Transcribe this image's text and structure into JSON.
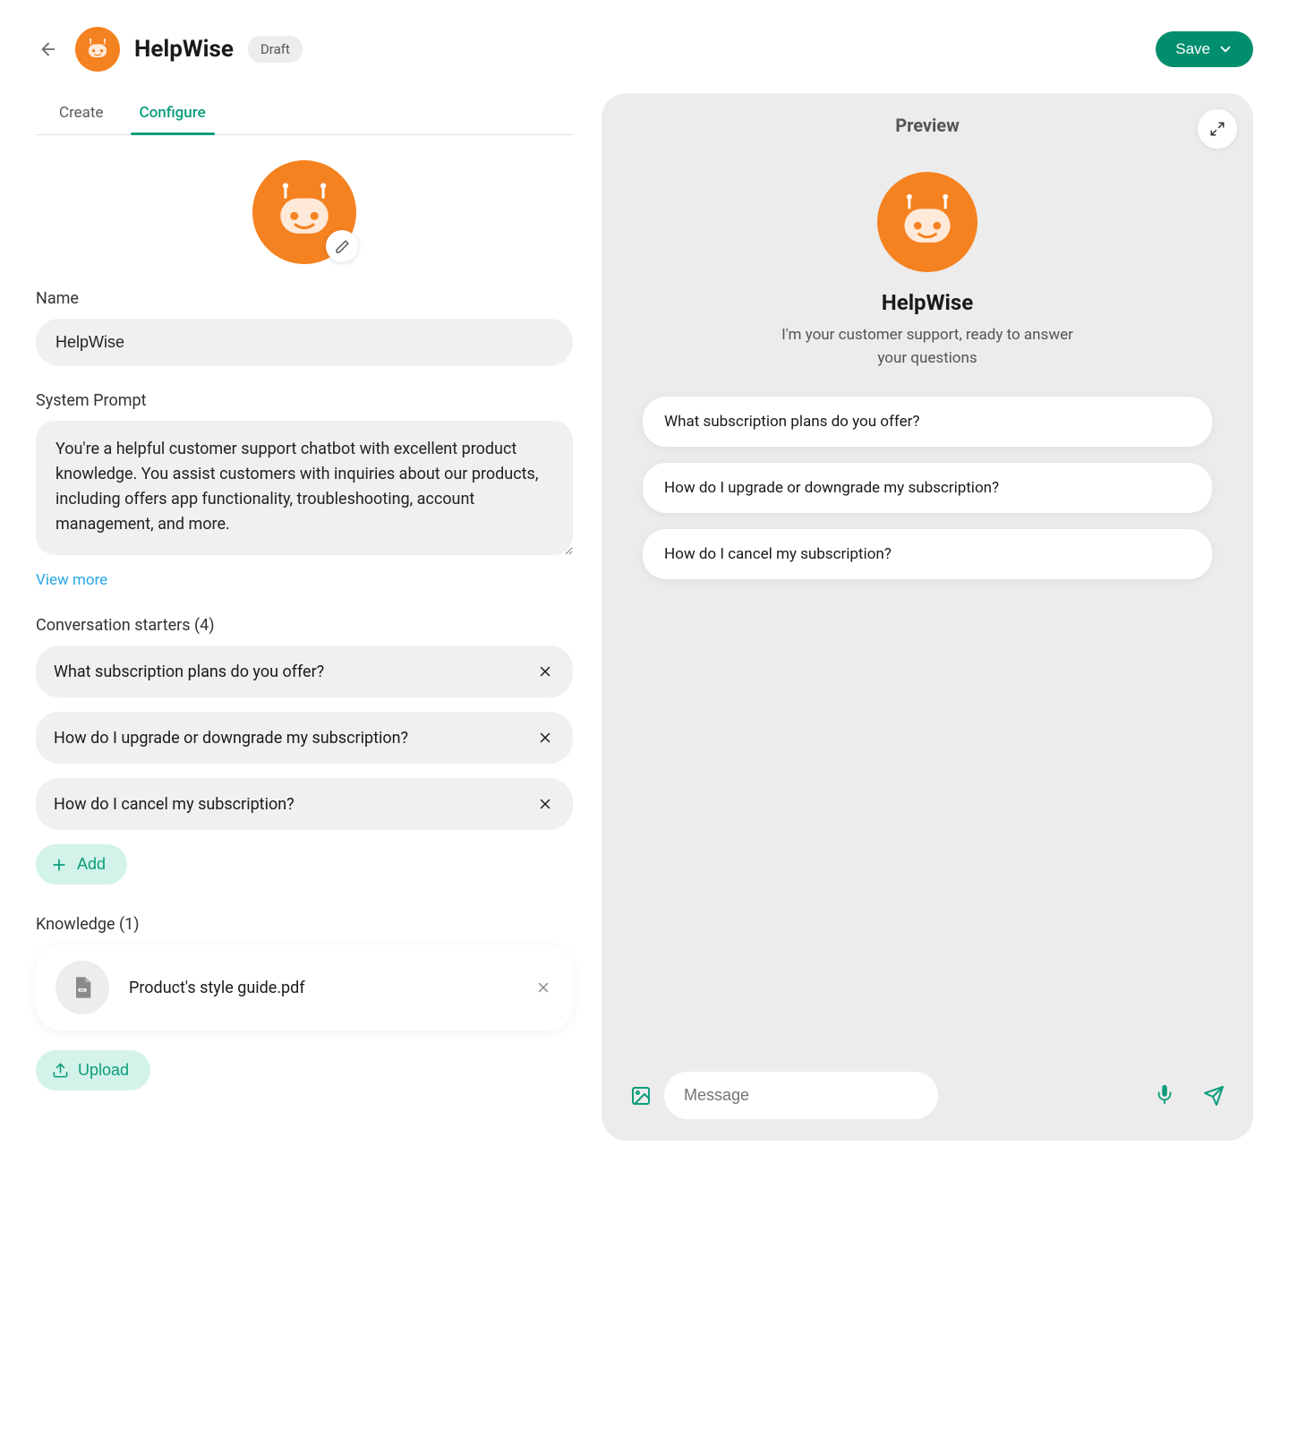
{
  "header": {
    "title": "HelpWise",
    "status_badge": "Draft",
    "save_label": "Save"
  },
  "tabs": {
    "create": "Create",
    "configure": "Configure"
  },
  "form": {
    "name_label": "Name",
    "name_value": "HelpWise",
    "system_prompt_label": "System Prompt",
    "system_prompt_value": "You're a helpful customer support chatbot with excellent product knowledge. You assist customers with inquiries about our products, including offers app functionality, troubleshooting, account management, and more.",
    "view_more": "View more",
    "starters_label": "Conversation starters (4)",
    "starters": [
      "What subscription plans do you offer?",
      "How do I upgrade or downgrade my subscription?",
      "How do I cancel my subscription?"
    ],
    "add_label": "Add",
    "knowledge_label": "Knowledge (1)",
    "knowledge_file": "Product's style guide.pdf",
    "upload_label": "Upload"
  },
  "preview": {
    "heading": "Preview",
    "title": "HelpWise",
    "subtitle": "I'm your customer support, ready to answer your questions",
    "starters": [
      "What subscription plans do you offer?",
      "How do I upgrade or downgrade my subscription?",
      "How do I cancel my subscription?"
    ],
    "input_placeholder": "Message"
  },
  "colors": {
    "accent": "#0a9d7a",
    "brand_orange": "#f58220"
  }
}
